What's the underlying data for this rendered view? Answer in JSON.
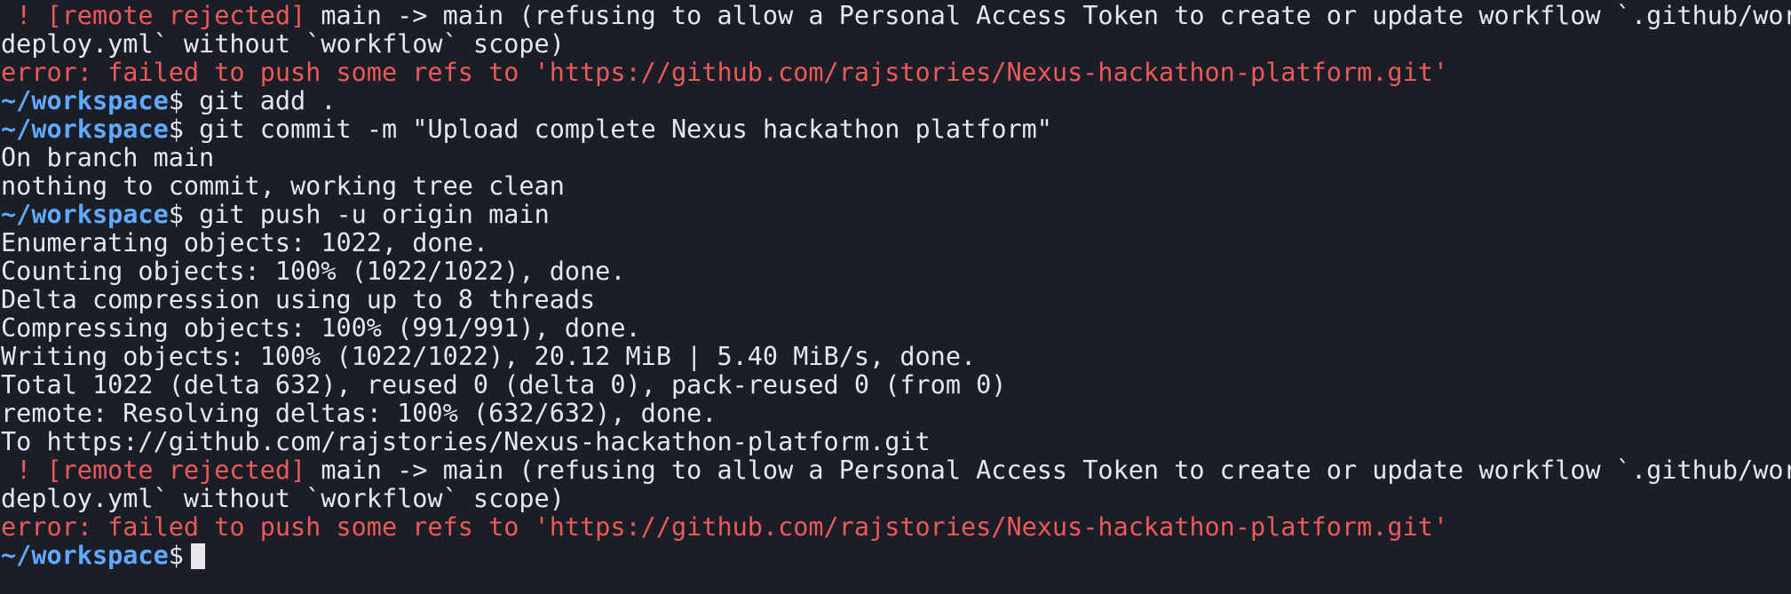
{
  "terminal": {
    "colors": {
      "background": "#1b1d27",
      "text": "#e7e8ec",
      "error": "#ec5a5a",
      "prompt": "#5fa9ff"
    },
    "prompt_path": "~/workspace",
    "prompt_symbol": "$",
    "lines": [
      {
        "kind": "reject",
        "tag": " ! [remote rejected]",
        "rest": " main -> main (refusing to allow a Personal Access Token to create or update workflow `.github/workflows/a"
      },
      {
        "kind": "plain",
        "text": "deploy.yml` without `workflow` scope)"
      },
      {
        "kind": "error",
        "text": "error: failed to push some refs to 'https://github.com/rajstories/Nexus-hackathon-platform.git'"
      },
      {
        "kind": "prompt",
        "command": " git add ."
      },
      {
        "kind": "prompt",
        "command": " git commit -m \"Upload complete Nexus hackathon platform\""
      },
      {
        "kind": "plain",
        "text": "On branch main"
      },
      {
        "kind": "plain",
        "text": "nothing to commit, working tree clean"
      },
      {
        "kind": "prompt",
        "command": " git push -u origin main"
      },
      {
        "kind": "plain",
        "text": "Enumerating objects: 1022, done."
      },
      {
        "kind": "plain",
        "text": "Counting objects: 100% (1022/1022), done."
      },
      {
        "kind": "plain",
        "text": "Delta compression using up to 8 threads"
      },
      {
        "kind": "plain",
        "text": "Compressing objects: 100% (991/991), done."
      },
      {
        "kind": "plain",
        "text": "Writing objects: 100% (1022/1022), 20.12 MiB | 5.40 MiB/s, done."
      },
      {
        "kind": "plain",
        "text": "Total 1022 (delta 632), reused 0 (delta 0), pack-reused 0 (from 0)"
      },
      {
        "kind": "plain",
        "text": "remote: Resolving deltas: 100% (632/632), done."
      },
      {
        "kind": "plain",
        "text": "To https://github.com/rajstories/Nexus-hackathon-platform.git"
      },
      {
        "kind": "reject",
        "tag": " ! [remote rejected]",
        "rest": " main -> main (refusing to allow a Personal Access Token to create or update workflow `.github/workflows/a"
      },
      {
        "kind": "plain",
        "text": "deploy.yml` without `workflow` scope)"
      },
      {
        "kind": "error",
        "text": "error: failed to push some refs to 'https://github.com/rajstories/Nexus-hackathon-platform.git'"
      },
      {
        "kind": "cursor-prompt",
        "command": ""
      }
    ]
  }
}
